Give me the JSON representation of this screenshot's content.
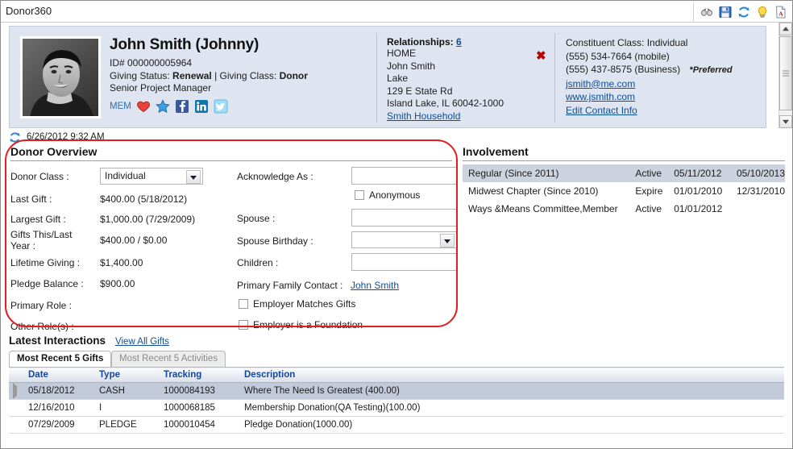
{
  "window": {
    "app_title": "Donor360"
  },
  "toolbar": {
    "icons": [
      {
        "name": "binoculars-icon",
        "label": "Search / Find"
      },
      {
        "name": "save-icon",
        "label": "Save"
      },
      {
        "name": "refresh-icon",
        "label": "Refresh"
      },
      {
        "name": "lightbulb-icon",
        "label": "Tips"
      },
      {
        "name": "report-icon",
        "label": "Report"
      }
    ]
  },
  "constituent": {
    "name": "John Smith (Johnny)",
    "id_line": "ID# 000000005964",
    "giving_status_label": "Giving Status:",
    "giving_status_value": "Renewal",
    "separator": "|",
    "giving_class_label": "Giving Class:",
    "giving_class_value": "Donor",
    "job_title": "Senior Project Manager",
    "mem_label": "MEM",
    "badges": [
      "heart-icon",
      "star-icon",
      "facebook-icon",
      "linkedin-icon",
      "twitter-icon"
    ]
  },
  "relationships": {
    "heading": "Relationships:",
    "count": "6",
    "type": "HOME",
    "person": "John Smith",
    "line3": "Lake",
    "street": "129 E State Rd",
    "citystatezip": "Island Lake, IL 60042-1000",
    "household_link": "Smith Household",
    "delete_glyph": "✖"
  },
  "contact": {
    "class_line": "Constituent Class: Individual",
    "phone_mobile": "(555) 534-7664 (mobile)",
    "phone_business": "(555) 437-8575 (Business)",
    "preferred_marker": "*Preferred",
    "email": "jsmith@me.com",
    "website": "www.jsmith.com",
    "edit_link": "Edit Contact Info"
  },
  "timestamp": {
    "text": "6/26/2012 9:32 AM"
  },
  "donor_overview": {
    "title": "Donor Overview",
    "left_fields": [
      {
        "label": "Donor Class :",
        "value": "Individual",
        "control": "select"
      },
      {
        "label": "Last Gift :",
        "value": "$400.00 (5/18/2012)",
        "control": "text"
      },
      {
        "label": "Largest Gift :",
        "value": "$1,000.00 (7/29/2009)",
        "control": "text"
      },
      {
        "label": "Gifts This/Last Year :",
        "value": "$400.00 / $0.00",
        "control": "text"
      },
      {
        "label": "Lifetime Giving :",
        "value": "$1,400.00",
        "control": "text"
      },
      {
        "label": "Pledge Balance :",
        "value": "$900.00",
        "control": "text"
      },
      {
        "label": "Primary Role :",
        "value": "",
        "control": "text"
      },
      {
        "label": "Other Role(s) :",
        "value": "",
        "control": "text"
      }
    ],
    "label_gifts_line1": "Gifts This/Last",
    "label_gifts_line2": "Year :",
    "acknowledge_label": "Acknowledge As :",
    "acknowledge_value": "",
    "acknowledge_placeholder": "",
    "anonymous_label": "Anonymous",
    "anonymous_checked": false,
    "spouse_label": "Spouse :",
    "spouse_value": "",
    "spouse_birthday_label": "Spouse Birthday :",
    "spouse_birthday_value": "",
    "children_label": "Children :",
    "children_value": "",
    "primary_family_contact_label": "Primary Family Contact :",
    "primary_family_contact_value": "John Smith",
    "employer_matches_label": "Employer Matches Gifts",
    "employer_matches_checked": false,
    "employer_foundation_label": "Employer is a Foundation",
    "employer_foundation_checked": false
  },
  "involvement": {
    "title": "Involvement",
    "rows": [
      {
        "name": "Regular (Since 2011)",
        "status": "Active",
        "start": "05/11/2012",
        "end": "05/10/2013",
        "selected": true
      },
      {
        "name": "Midwest Chapter (Since 2010)",
        "status": "Expire",
        "start": "01/01/2010",
        "end": "12/31/2010",
        "selected": false
      },
      {
        "name": "Ways &Means Committee,Member",
        "status": "Active",
        "start": "01/01/2012",
        "end": "",
        "selected": false
      }
    ]
  },
  "latest_interactions": {
    "title": "Latest Interactions",
    "view_all_link": "View All Gifts",
    "tabs": [
      {
        "label": "Most Recent 5 Gifts",
        "active": true
      },
      {
        "label": "Most Recent 5 Activities",
        "active": false
      }
    ],
    "columns": [
      "Date",
      "Type",
      "Tracking",
      "Description"
    ],
    "rows": [
      {
        "date": "05/18/2012",
        "type": "CASH",
        "tracking": "1000084193",
        "description": "Where The Need Is Greatest (400.00)",
        "selected": true
      },
      {
        "date": "12/16/2010",
        "type": "I",
        "tracking": "1000068185",
        "description": "Membership Donation(QA Testing)(100.00)",
        "selected": false
      },
      {
        "date": "07/29/2009",
        "type": "PLEDGE",
        "tracking": "1000010454",
        "description": "Pledge Donation(1000.00)",
        "selected": false
      }
    ]
  },
  "colors": {
    "card_bg": "#dfe5f0",
    "link": "#0d4e96",
    "annotation_red": "#e02020",
    "status_active": "#0a7a12",
    "status_expire": "#d01616",
    "grid_header_text": "#13459b",
    "row_selected": "#c2cada"
  }
}
